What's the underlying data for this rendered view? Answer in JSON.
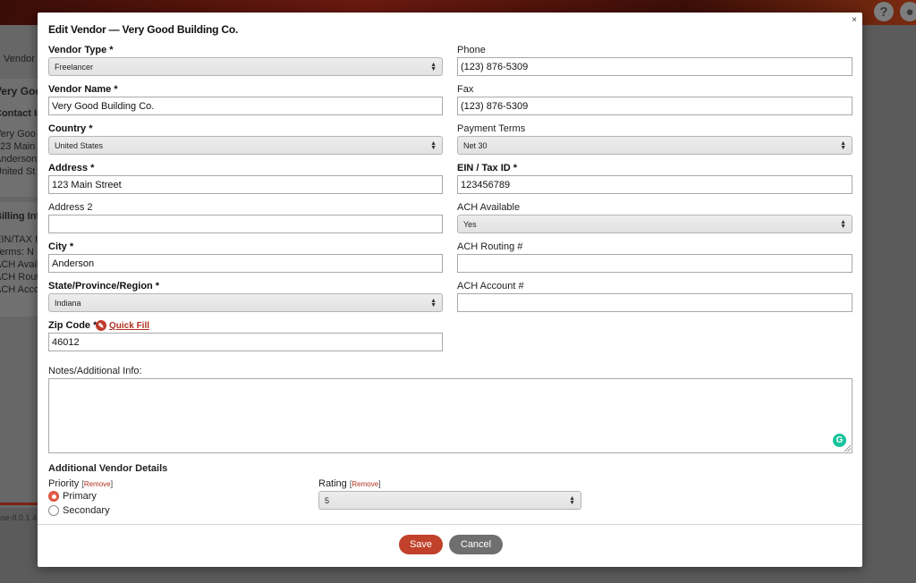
{
  "background": {
    "vendor_tab": "Vendor",
    "vendor_name": "Very Good",
    "contact_header": "Contact In",
    "address_lines": [
      "Very Goo",
      "123 Main",
      "Anderson",
      "United St"
    ],
    "billing_header": "Billing Info",
    "billing_lines": [
      "EIN/TAX I",
      "Terms: N",
      "ACH Avail",
      "ACH Rout",
      "ACH Accou"
    ],
    "footer_text": "ase-8.0.1 4",
    "help_icon_glyph": "?",
    "user_icon_glyph": "●"
  },
  "modal": {
    "title": "Edit Vendor — Very Good Building Co.",
    "close_glyph": "×",
    "left_fields": {
      "vendor_type": {
        "label": "Vendor Type *",
        "value": "Freelancer"
      },
      "vendor_name": {
        "label": "Vendor Name *",
        "value": "Very Good Building Co."
      },
      "country": {
        "label": "Country *",
        "value": "United States"
      },
      "address": {
        "label": "Address *",
        "value": "123 Main Street"
      },
      "address2": {
        "label": "Address 2",
        "value": ""
      },
      "city": {
        "label": "City *",
        "value": "Anderson"
      },
      "state": {
        "label": "State/Province/Region *",
        "value": "Indiana"
      },
      "zip": {
        "label": "Zip Code *",
        "value": "46012",
        "quick_fill": "Quick Fill"
      }
    },
    "right_fields": {
      "phone": {
        "label": "Phone",
        "value": "(123) 876-5309"
      },
      "fax": {
        "label": "Fax",
        "value": "(123) 876-5309"
      },
      "payment_terms": {
        "label": "Payment Terms",
        "value": "Net 30"
      },
      "ein": {
        "label": "EIN / Tax ID *",
        "value": "123456789"
      },
      "ach_available": {
        "label": "ACH Available",
        "value": "Yes"
      },
      "ach_routing": {
        "label": "ACH Routing #",
        "value": ""
      },
      "ach_account": {
        "label": "ACH Account #",
        "value": ""
      }
    },
    "notes": {
      "label": "Notes/Additional Info:",
      "value": ""
    },
    "additional": {
      "title": "Additional Vendor Details",
      "priority_label": "Priority",
      "remove_label": "Remove",
      "priority_options": [
        {
          "label": "Primary",
          "selected": true
        },
        {
          "label": "Secondary",
          "selected": false
        }
      ],
      "rating_label": "Rating",
      "rating_value": "5"
    },
    "buttons": {
      "save": "Save",
      "cancel": "Cancel"
    }
  },
  "colors": {
    "accent": "#c1412a",
    "link": "#b0301f",
    "cancel": "#6f6f6f",
    "grammarly": "#15c39a"
  }
}
